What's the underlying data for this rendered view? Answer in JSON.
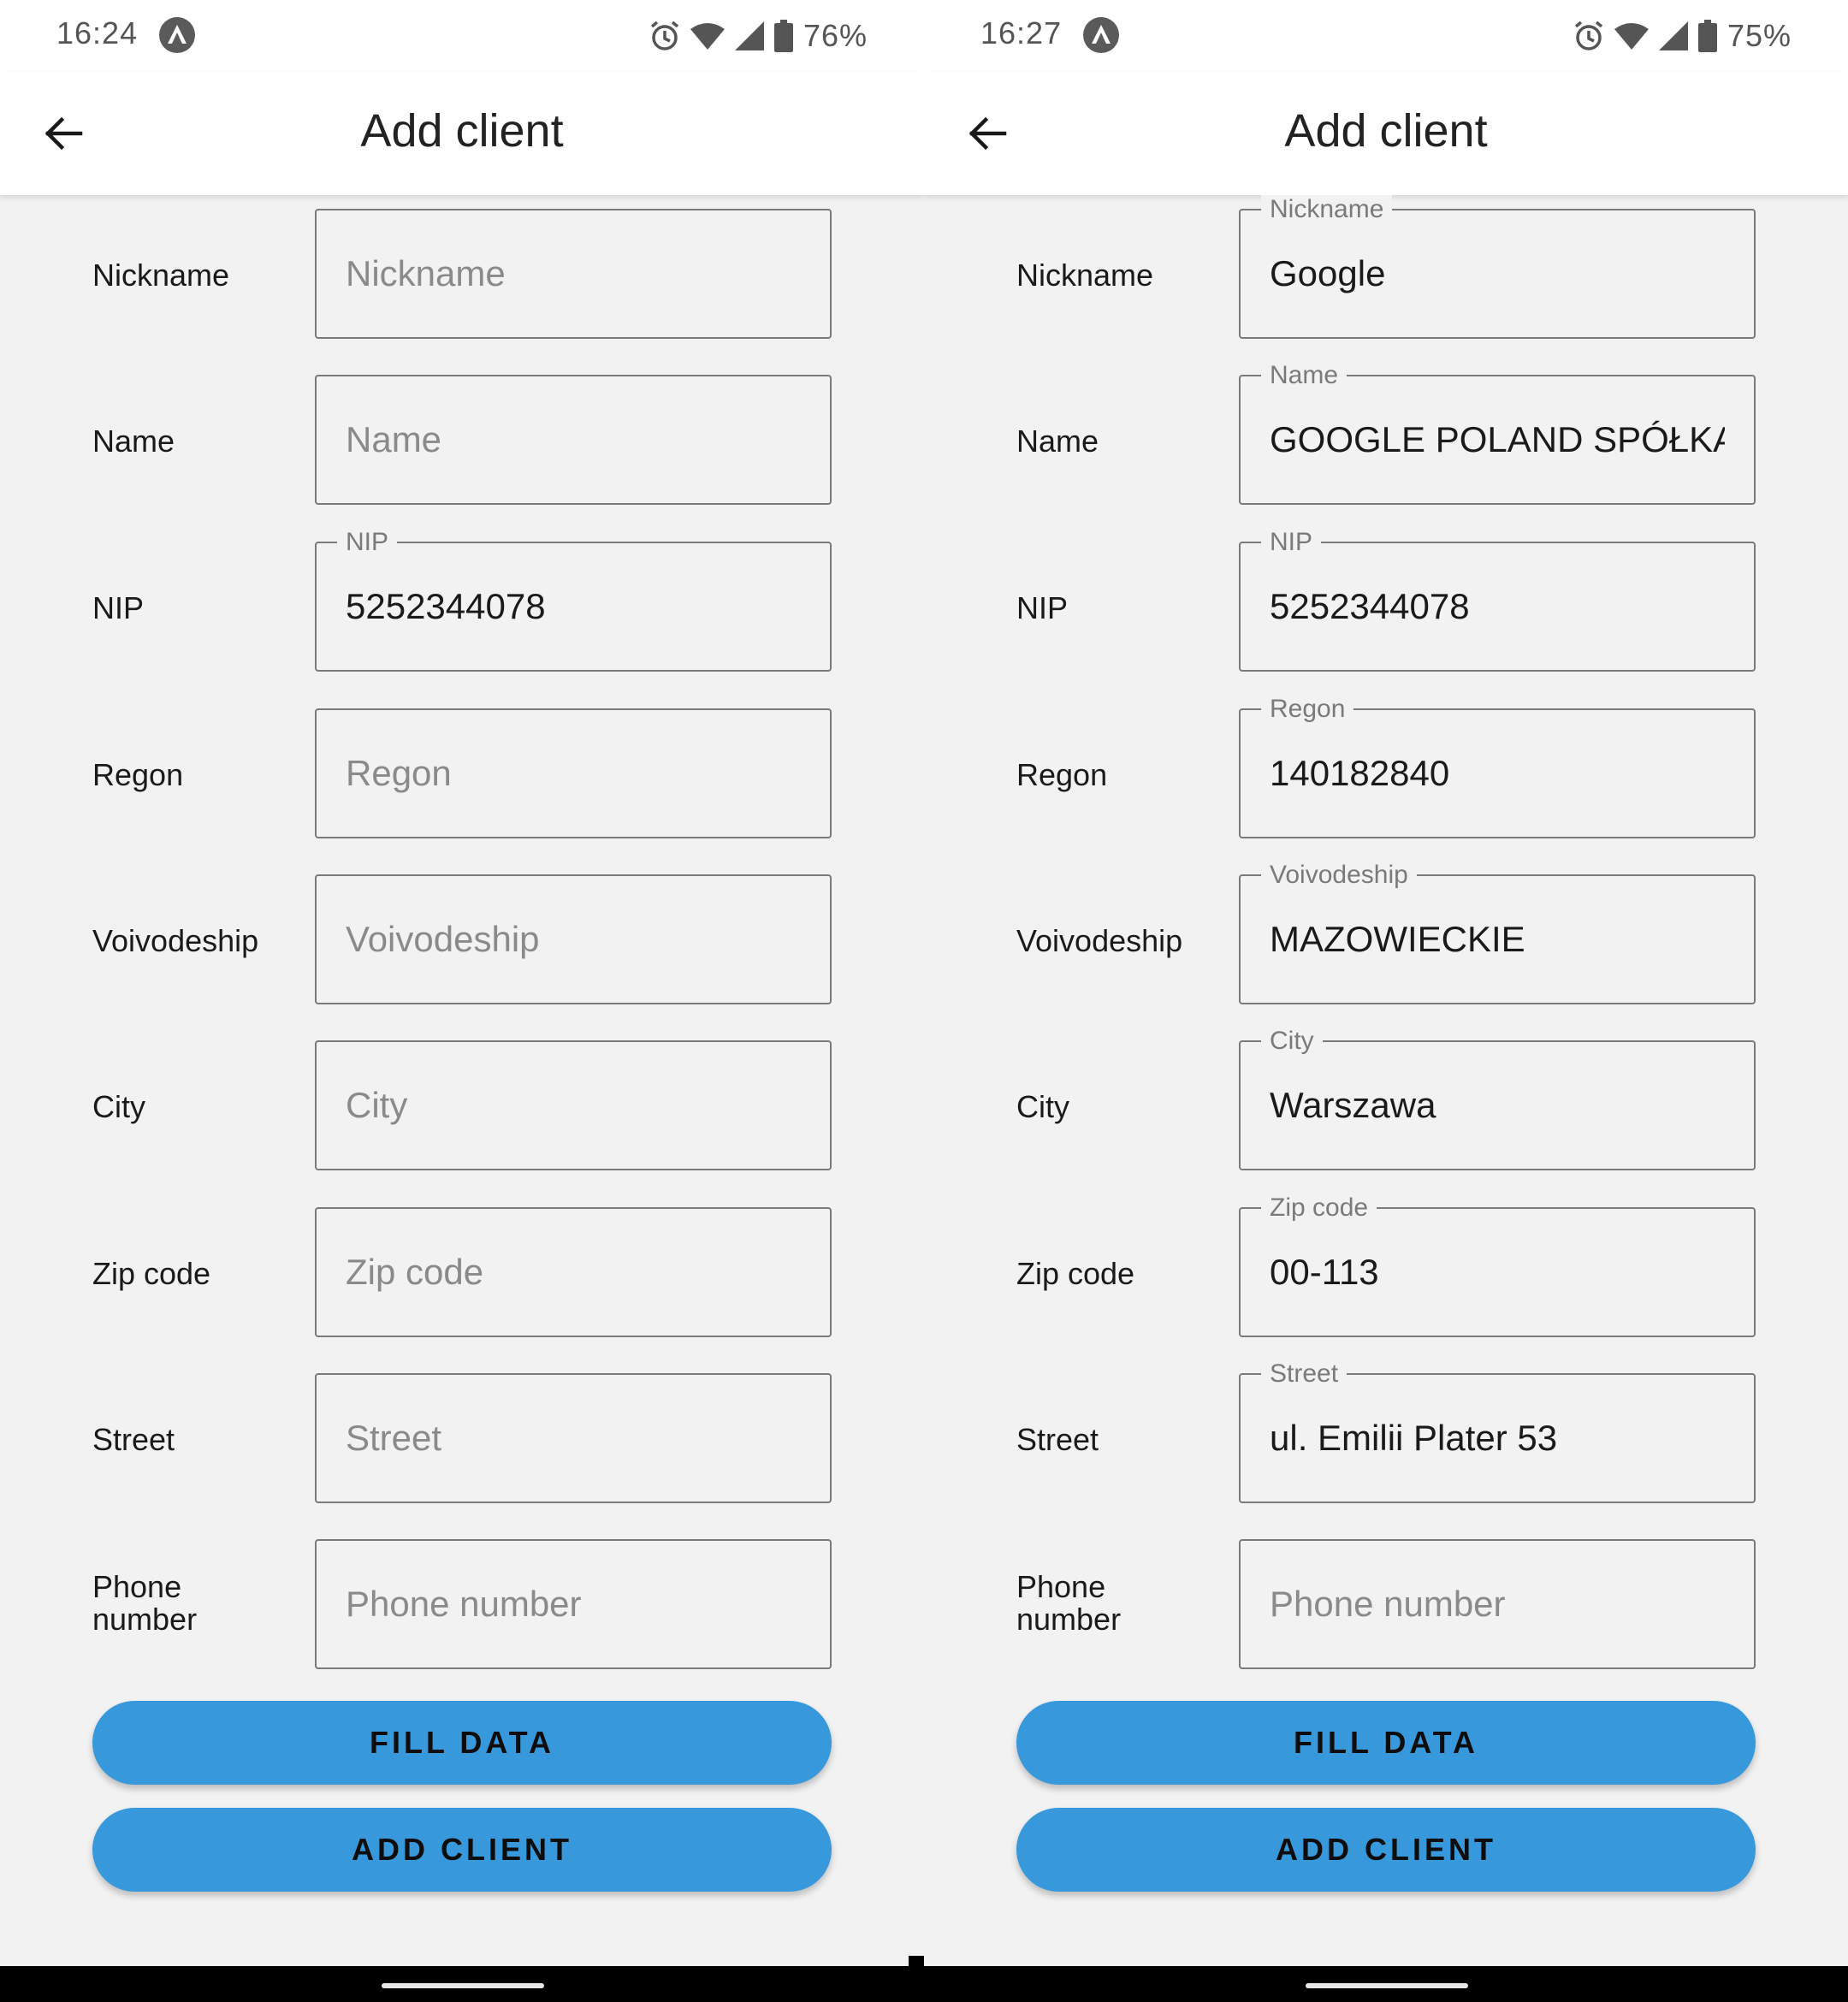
{
  "left": {
    "status": {
      "time": "16:24",
      "battery": "76%"
    },
    "title": "Add client",
    "fields": [
      {
        "label": "Nickname",
        "value": "",
        "placeholder": "Nickname",
        "notch": ""
      },
      {
        "label": "Name",
        "value": "",
        "placeholder": "Name",
        "notch": ""
      },
      {
        "label": "NIP",
        "value": "5252344078",
        "placeholder": "NIP",
        "notch": "NIP"
      },
      {
        "label": "Regon",
        "value": "",
        "placeholder": "Regon",
        "notch": ""
      },
      {
        "label": "Voivodeship",
        "value": "",
        "placeholder": "Voivodeship",
        "notch": ""
      },
      {
        "label": "City",
        "value": "",
        "placeholder": "City",
        "notch": ""
      },
      {
        "label": "Zip code",
        "value": "",
        "placeholder": "Zip code",
        "notch": ""
      },
      {
        "label": "Street",
        "value": "",
        "placeholder": "Street",
        "notch": ""
      },
      {
        "label_line1": "Phone",
        "label_line2": "number",
        "value": "",
        "placeholder": "Phone number",
        "notch": ""
      }
    ],
    "buttons": {
      "fill": "FILL DATA",
      "add": "ADD CLIENT"
    }
  },
  "right": {
    "status": {
      "time": "16:27",
      "battery": "75%"
    },
    "title": "Add client",
    "fields": [
      {
        "label": "Nickname",
        "value": "Google",
        "placeholder": "Nickname",
        "notch": "Nickname"
      },
      {
        "label": "Name",
        "value": "GOOGLE POLAND SPÓŁKA Z",
        "placeholder": "Name",
        "notch": "Name"
      },
      {
        "label": "NIP",
        "value": "5252344078",
        "placeholder": "NIP",
        "notch": "NIP"
      },
      {
        "label": "Regon",
        "value": "140182840",
        "placeholder": "Regon",
        "notch": "Regon"
      },
      {
        "label": "Voivodeship",
        "value": "MAZOWIECKIE",
        "placeholder": "Voivodeship",
        "notch": "Voivodeship"
      },
      {
        "label": "City",
        "value": "Warszawa",
        "placeholder": "City",
        "notch": "City"
      },
      {
        "label": "Zip code",
        "value": "00-113",
        "placeholder": "Zip code",
        "notch": "Zip code"
      },
      {
        "label": "Street",
        "value": "ul. Emilii Plater 53",
        "placeholder": "Street",
        "notch": "Street"
      },
      {
        "label_line1": "Phone",
        "label_line2": "number",
        "value": "",
        "placeholder": "Phone number",
        "notch": ""
      }
    ],
    "buttons": {
      "fill": "FILL DATA",
      "add": "ADD CLIENT"
    }
  },
  "icons": {
    "back": "arrow-left-icon",
    "app": "app-notification-icon",
    "alarm": "alarm-icon",
    "wifi": "wifi-icon",
    "signal": "signal-icon",
    "battery": "battery-icon"
  },
  "colors": {
    "accent": "#3799db",
    "background": "#f2f2f2",
    "appbar": "#ffffff"
  }
}
